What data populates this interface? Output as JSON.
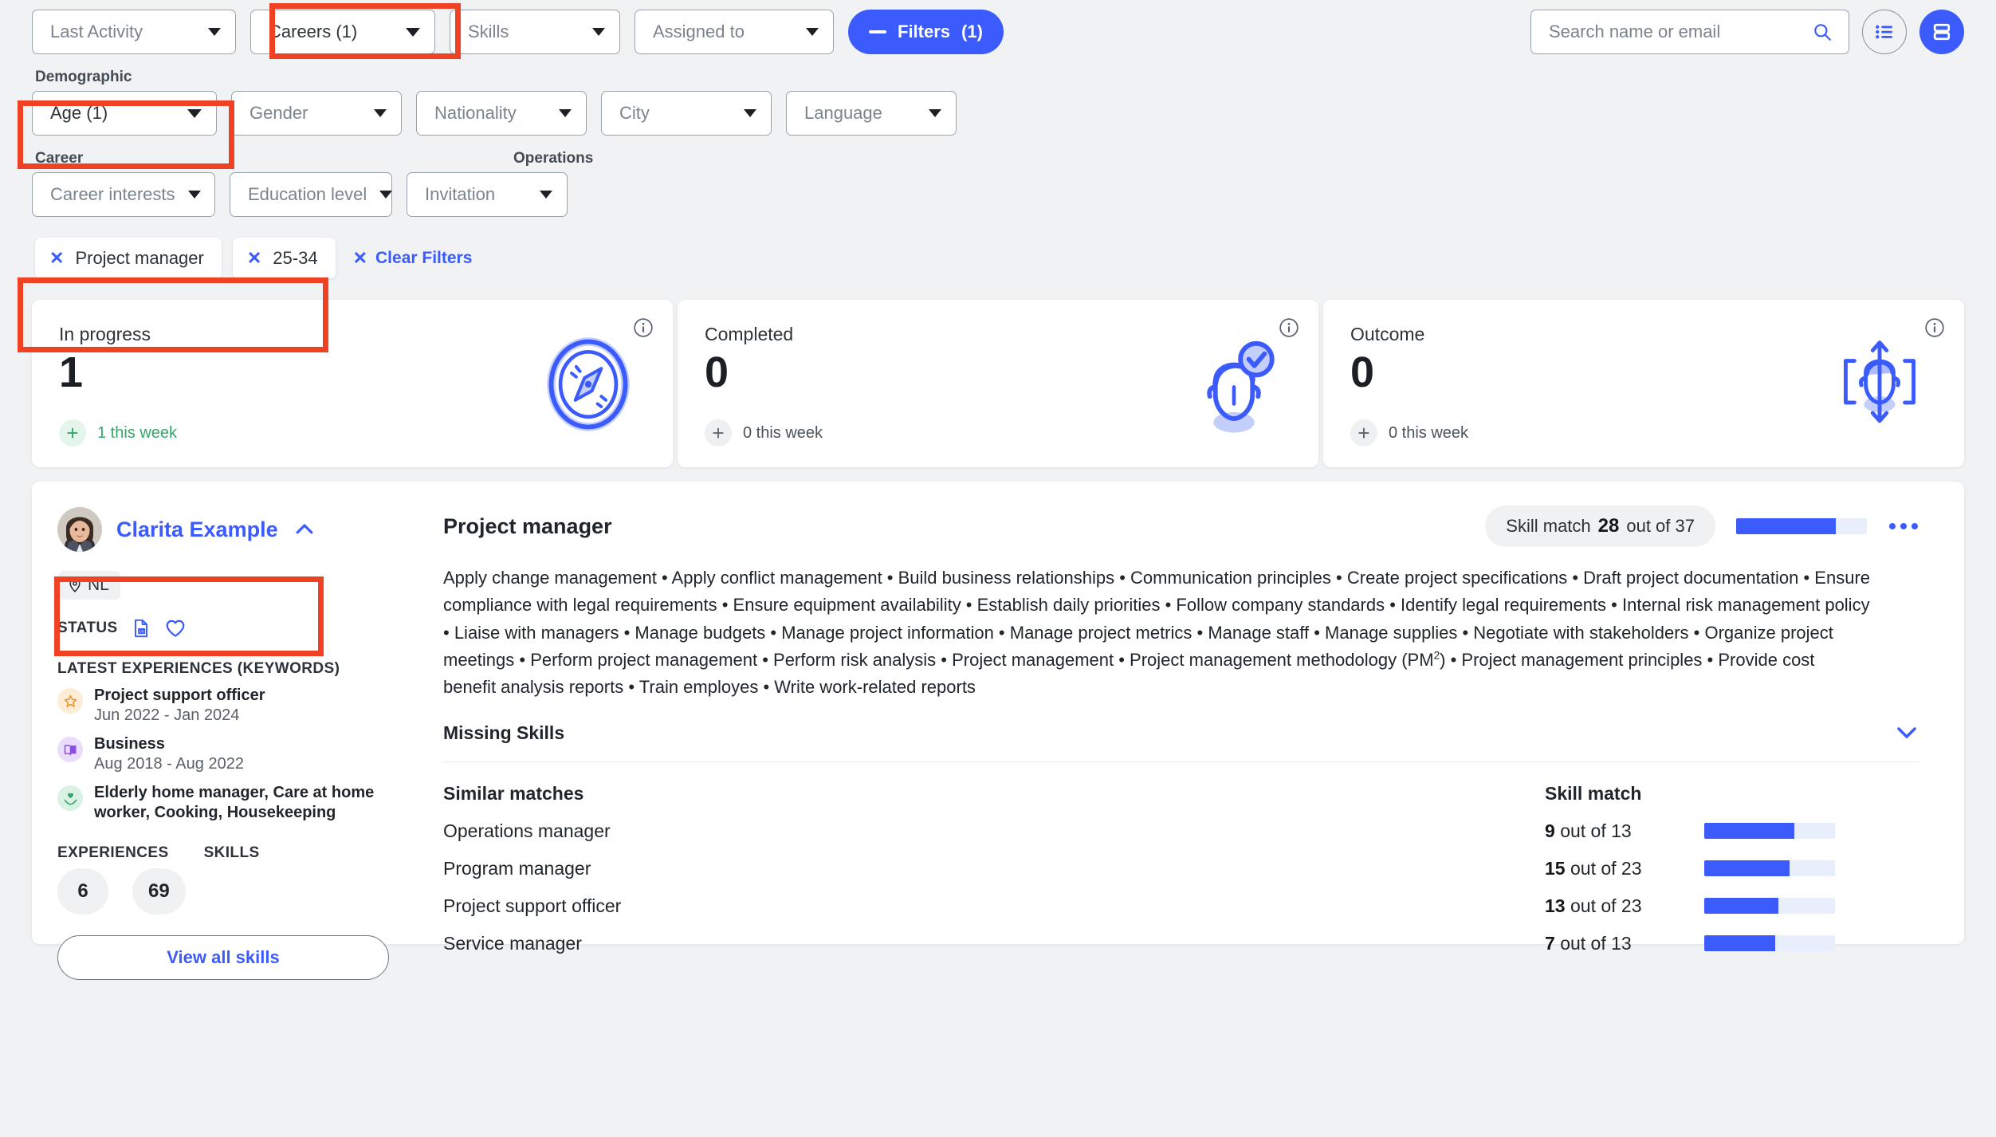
{
  "filters": {
    "row1": [
      {
        "label": "Last Activity",
        "selected": false,
        "name": "last-activity"
      },
      {
        "label": "Careers (1)",
        "selected": true,
        "name": "careers"
      },
      {
        "label": "Skills",
        "selected": false,
        "name": "skills"
      },
      {
        "label": "Assigned to",
        "selected": false,
        "name": "assigned-to"
      }
    ],
    "filters_button": {
      "label": "Filters",
      "count": "(1)"
    },
    "demographic_label": "Demographic",
    "row2": [
      {
        "label": "Age (1)",
        "selected": true,
        "name": "age"
      },
      {
        "label": "Gender",
        "selected": false,
        "name": "gender"
      },
      {
        "label": "Nationality",
        "selected": false,
        "name": "nationality"
      },
      {
        "label": "City",
        "selected": false,
        "name": "city"
      },
      {
        "label": "Language",
        "selected": false,
        "name": "language"
      }
    ],
    "career_label": "Career",
    "operations_label": "Operations",
    "row3": [
      {
        "label": "Career interests",
        "selected": false,
        "name": "career-interests"
      },
      {
        "label": "Education level",
        "selected": false,
        "name": "education-level"
      },
      {
        "label": "Invitation",
        "selected": false,
        "name": "invitation"
      }
    ],
    "chips": [
      "Project manager",
      "25-34"
    ],
    "clear_filters": "Clear Filters"
  },
  "search": {
    "placeholder": "Search name or email",
    "value": ""
  },
  "stats": [
    {
      "title": "In progress",
      "value": "1",
      "week": "1 this week",
      "icon": "compass-icon",
      "tone": "green",
      "name": "in-progress"
    },
    {
      "title": "Completed",
      "value": "0",
      "week": "0 this week",
      "icon": "person-check-icon",
      "tone": "gray",
      "name": "completed"
    },
    {
      "title": "Outcome",
      "value": "0",
      "week": "0 this week",
      "icon": "person-target-icon",
      "tone": "gray",
      "name": "outcome"
    }
  ],
  "person": {
    "name": "Clarita Example",
    "location": "NL",
    "status_label": "STATUS",
    "experiences_label": "LATEST EXPERIENCES (KEYWORDS)",
    "experiences": [
      {
        "title": "Project support officer",
        "dates": "Jun 2022 - Jan 2024",
        "badge": "star-icon",
        "tone": "orange"
      },
      {
        "title": "Business",
        "dates": "Aug 2018 - Aug 2022",
        "badge": "book-icon",
        "tone": "purple"
      },
      {
        "title": "Elderly home manager, Care at home worker, Cooking, Housekeeping",
        "dates": "",
        "badge": "care-heart-icon",
        "tone": "green"
      }
    ],
    "experiences_count_label": "EXPERIENCES",
    "experiences_count": "6",
    "skills_count_label": "SKILLS",
    "skills_count": "69",
    "view_all_skills": "View all skills"
  },
  "role": {
    "title": "Project manager",
    "skill_match_label": "Skill match",
    "skill_match_value": "28",
    "skill_match_of": "out of 37",
    "skill_match_pct": 76,
    "skills_text": "Apply change management • Apply conflict management • Build business relationships • Communication principles • Create project specifications • Draft project documentation • Ensure compliance with legal requirements • Ensure equipment availability • Establish daily priorities • Follow company standards • Identify legal requirements • Internal risk management policy • Liaise with managers • Manage budgets • Manage project information • Manage project metrics • Manage staff • Manage supplies • Negotiate with stakeholders • Organize project meetings • Perform project management • Perform risk analysis • Project management • Project management methodology (PM²) • Project management principles • Provide cost benefit analysis reports • Train employes • Write work-related reports",
    "missing_skills_label": "Missing Skills"
  },
  "similar": {
    "title": "Similar matches",
    "skill_match_header": "Skill match",
    "rows": [
      {
        "name": "Operations manager",
        "score": "9",
        "of": "out of 13",
        "pct": 69
      },
      {
        "name": "Program manager",
        "score": "15",
        "of": "out of 23",
        "pct": 65
      },
      {
        "name": "Project support officer",
        "score": "13",
        "of": "out of 23",
        "pct": 57
      },
      {
        "name": "Service manager",
        "score": "7",
        "of": "out of 13",
        "pct": 54
      }
    ]
  },
  "colors": {
    "accent": "#3b5bfd",
    "annotation": "#ef4123",
    "green": "#34a76a"
  }
}
